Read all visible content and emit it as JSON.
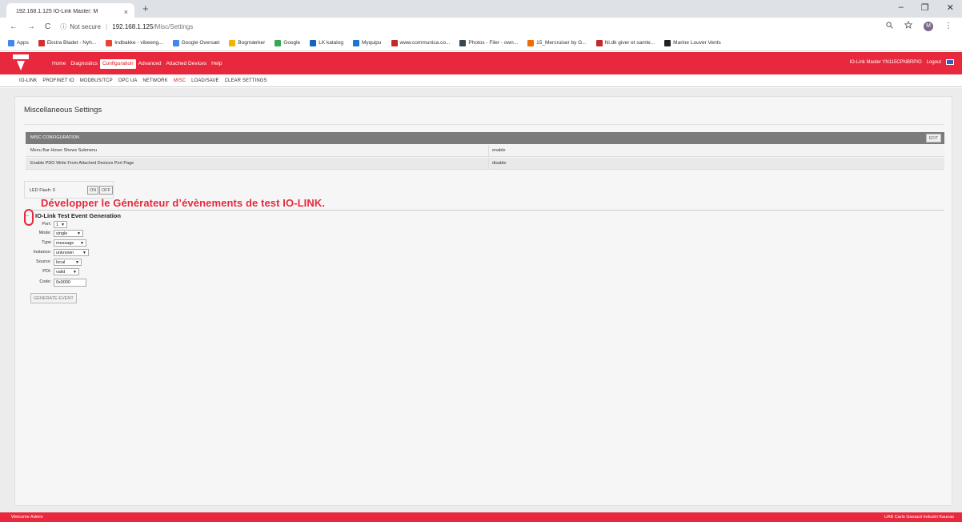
{
  "browser": {
    "tab_title": "192.168.1.125 IO-Link Master: M",
    "tab_close": "×",
    "new_tab": "+",
    "window_controls": [
      "–",
      "❐",
      "✕"
    ],
    "nav": {
      "back": "←",
      "forward": "→",
      "reload": "C"
    },
    "security_icon": "ⓘ",
    "security_label": "Not secure",
    "url_sep": "|",
    "url_host": "192.168.1.125",
    "url_path": "/Misc/Settings",
    "avatar_letter": "M",
    "zoom_icon": "zoom-icon",
    "star_icon": "star-icon",
    "menu_icon": "⋮",
    "bookmarks": [
      {
        "label": "Apps",
        "color": "#4285f4"
      },
      {
        "label": "Ekstra Bladet - Nyh...",
        "color": "#d32f2f"
      },
      {
        "label": "Indbakke - vibeeng...",
        "color": "#ea4335"
      },
      {
        "label": "Google Oversæt",
        "color": "#4285f4"
      },
      {
        "label": "Bogmærker",
        "color": "#f4b400"
      },
      {
        "label": "Google",
        "color": "#34a853"
      },
      {
        "label": "LK katalog",
        "color": "#1565c0"
      },
      {
        "label": "Myquipu",
        "color": "#1976d2"
      },
      {
        "label": "www.communica.co...",
        "color": "#c62828"
      },
      {
        "label": "Photos - Filer - own...",
        "color": "#37474f"
      },
      {
        "label": "15_Mercruiser by G...",
        "color": "#ef6c00"
      },
      {
        "label": "Ni.dk giver et samle...",
        "color": "#c62828"
      },
      {
        "label": "Marine Louver Vents",
        "color": "#212121"
      }
    ]
  },
  "app": {
    "menu": [
      {
        "label": "Home",
        "active": false
      },
      {
        "label": "Diagnostics",
        "active": false
      },
      {
        "label": "Configuration",
        "active": true
      },
      {
        "label": "Advanced",
        "active": false
      },
      {
        "label": "Attached Devices",
        "active": false
      },
      {
        "label": "Help",
        "active": false
      }
    ],
    "device_name": "IO-Link Master YN115CPNBRPIO",
    "logout": "Logout",
    "submenu": [
      {
        "label": "IO-LINK",
        "active": false
      },
      {
        "label": "PROFINET IO",
        "active": false
      },
      {
        "label": "MODBUS/TCP",
        "active": false
      },
      {
        "label": "OPC UA",
        "active": false
      },
      {
        "label": "NETWORK",
        "active": false
      },
      {
        "label": "MISC",
        "active": true
      },
      {
        "label": "LOAD/SAVE",
        "active": false
      },
      {
        "label": "CLEAR SETTINGS",
        "active": false
      }
    ],
    "accent_color": "#e8283c"
  },
  "page": {
    "title": "Miscellaneous Settings",
    "config": {
      "header": "MISC CONFIGURATION",
      "edit_label": "EDIT",
      "rows": [
        {
          "key": "Menu Bar Hover Shows Submenu",
          "value": "enable"
        },
        {
          "key": "Enable PDO Write From Attached Devices Port Page",
          "value": "disable"
        }
      ]
    },
    "led": {
      "label": "LED Flash: 0",
      "on": "ON",
      "off": "OFF"
    },
    "callout": "Développer le Générateur d’évènements de test IO-LINK.",
    "event": {
      "toggle": "–",
      "title": "IO-Link Test Event Generation",
      "fields": [
        {
          "label": "Port:",
          "value": "1"
        },
        {
          "label": "Mode:",
          "value": "single"
        },
        {
          "label": "Type",
          "value": "message"
        },
        {
          "label": "Instance:",
          "value": "unknown"
        },
        {
          "label": "Source:",
          "value": "local"
        },
        {
          "label": "PDI:",
          "value": "valid"
        },
        {
          "label": "Code:",
          "value": "0x0000"
        }
      ],
      "button": "GENERATE EVENT"
    }
  },
  "footer": {
    "left": "Welcome Admin",
    "right": "UAB Carlo Gavazzi Industri Kaunas"
  }
}
